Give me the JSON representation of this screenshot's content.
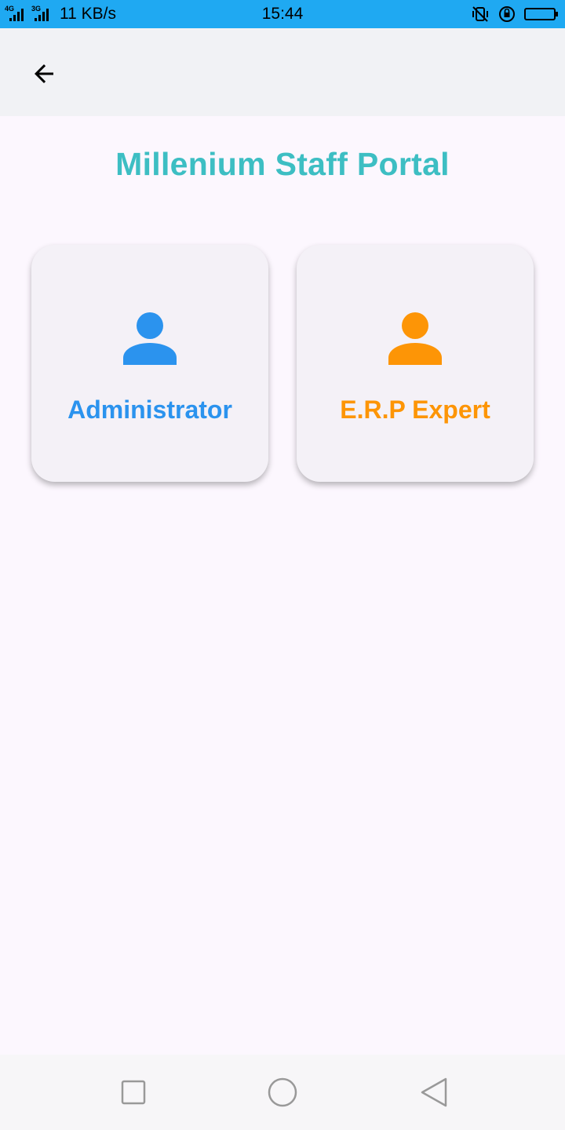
{
  "status_bar": {
    "network_1": "4G",
    "network_2": "3G",
    "speed": "11 KB/s",
    "time": "15:44"
  },
  "app_bar": {
    "back_icon": "arrow-left-icon"
  },
  "page": {
    "title": "Millenium Staff Portal"
  },
  "cards": [
    {
      "label": "Administrator",
      "icon": "person-icon",
      "color": "#2B93EE"
    },
    {
      "label": "E.R.P Expert",
      "icon": "person-icon",
      "color": "#FD9506"
    }
  ],
  "nav_bar": {
    "items": [
      "square-recents-icon",
      "circle-home-icon",
      "triangle-back-icon"
    ]
  },
  "colors": {
    "status_bar": "#1FA9F2",
    "title": "#3DBEC3",
    "background": "#FCF7FE",
    "app_bar": "#F1F2F5"
  }
}
